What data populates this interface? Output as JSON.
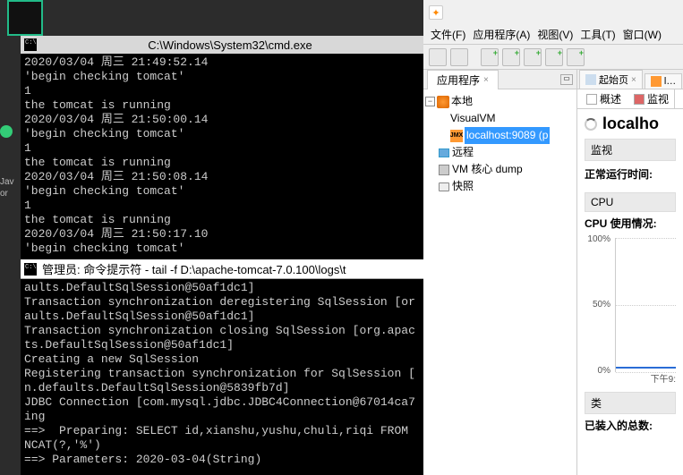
{
  "bg": {
    "label_jav": "Jav",
    "label_or": "or"
  },
  "cmd1": {
    "title": "C:\\Windows\\System32\\cmd.exe",
    "lines": "2020/03/04 周三 21:49:52.14\n'begin checking tomcat'\n1\nthe tomcat is running\n2020/03/04 周三 21:50:00.14\n'begin checking tomcat'\n1\nthe tomcat is running\n2020/03/04 周三 21:50:08.14\n'begin checking tomcat'\n1\nthe tomcat is running\n2020/03/04 周三 21:50:17.10\n'begin checking tomcat'"
  },
  "cmd2": {
    "title": "管理员: 命令提示符 - tail  -f D:\\apache-tomcat-7.0.100\\logs\\t",
    "lines": "aults.DefaultSqlSession@50af1dc1]\nTransaction synchronization deregistering SqlSession [or\naults.DefaultSqlSession@50af1dc1]\nTransaction synchronization closing SqlSession [org.apac\nts.DefaultSqlSession@50af1dc1]\nCreating a new SqlSession\nRegistering transaction synchronization for SqlSession [\nn.defaults.DefaultSqlSession@5839fb7d]\nJDBC Connection [com.mysql.jdbc.JDBC4Connection@67014ca7\ning\n==>  Preparing: SELECT id,xianshu,yushu,chuli,riqi FROM \nNCAT(?,'%')\n==> Parameters: 2020-03-04(String)"
  },
  "vvm": {
    "menu": {
      "file": "文件(F)",
      "app": "应用程序(A)",
      "view": "视图(V)",
      "tools": "工具(T)",
      "window": "窗口(W)"
    },
    "left_tab": "应用程序",
    "tree": {
      "local": "本地",
      "visualvm": "VisualVM",
      "jmx_sel": "localhost:9089 (p",
      "remote": "远程",
      "dump": "VM 核心 dump",
      "snapshot": "快照"
    },
    "right_tabs": {
      "start": "起始页",
      "jmx": "l…"
    },
    "sub_tabs": {
      "overview": "概述",
      "monitor": "监视"
    },
    "content": {
      "title": "localho",
      "monitor_hdr": "监视",
      "uptime_label": "正常运行时间:",
      "cpu_hdr": "CPU",
      "cpu_usage": "CPU 使用情况:",
      "class_hdr": "类",
      "loaded_label": "已装入的总数:"
    }
  },
  "chart_data": {
    "type": "line",
    "title": "CPU 使用情况",
    "ylabel": "%",
    "ylim": [
      0,
      100
    ],
    "yticks": [
      0,
      50,
      100
    ],
    "xtick_visible": "下午9:",
    "series": [
      {
        "name": "CPU",
        "values": [
          3,
          2
        ]
      }
    ]
  }
}
